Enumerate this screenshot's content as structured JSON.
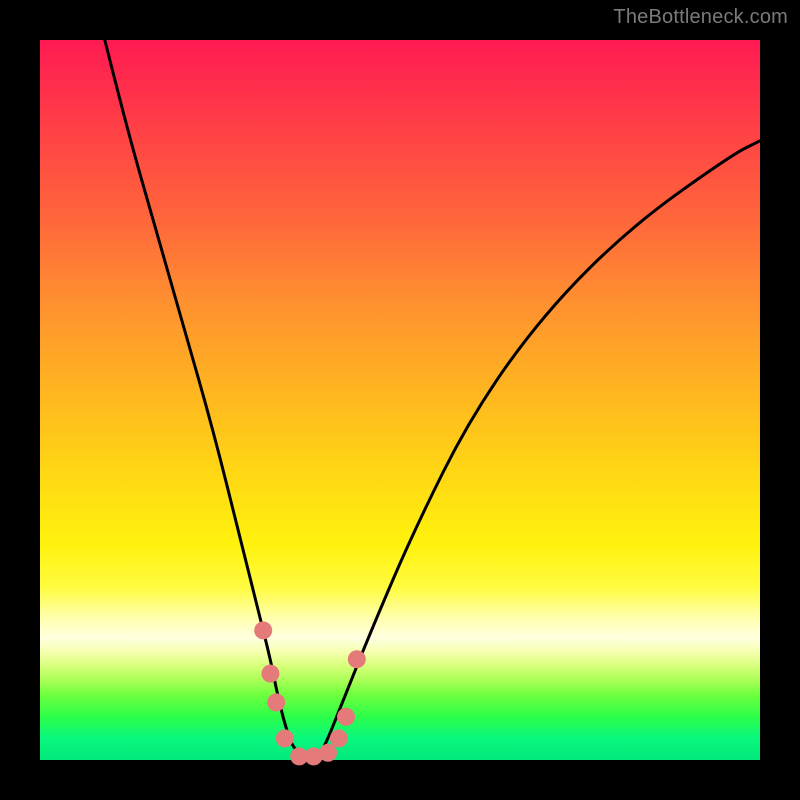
{
  "watermark": "TheBottleneck.com",
  "chart_data": {
    "type": "line",
    "title": "",
    "xlabel": "",
    "ylabel": "",
    "xlim": [
      0,
      100
    ],
    "ylim": [
      0,
      100
    ],
    "series": [
      {
        "name": "bottleneck-curve",
        "x": [
          9,
          12,
          16,
          20,
          24,
          28,
          30,
          32,
          33,
          34,
          35,
          36,
          37,
          38,
          39,
          40,
          42,
          46,
          52,
          60,
          70,
          82,
          96,
          100
        ],
        "y": [
          100,
          88,
          74,
          60,
          46,
          30,
          22,
          14,
          9,
          5,
          2,
          1,
          0,
          0,
          1,
          3,
          8,
          18,
          32,
          48,
          62,
          74,
          84,
          86
        ],
        "color": "#000000",
        "width": 3
      }
    ],
    "markers": [
      {
        "x": 31.0,
        "y": 18.0,
        "r": 9,
        "color": "#e47a7a"
      },
      {
        "x": 32.0,
        "y": 12.0,
        "r": 9,
        "color": "#e47a7a"
      },
      {
        "x": 32.8,
        "y": 8.0,
        "r": 9,
        "color": "#e47a7a"
      },
      {
        "x": 34.0,
        "y": 3.0,
        "r": 9,
        "color": "#e47a7a"
      },
      {
        "x": 36.0,
        "y": 0.5,
        "r": 9,
        "color": "#e47a7a"
      },
      {
        "x": 38.0,
        "y": 0.5,
        "r": 9,
        "color": "#e47a7a"
      },
      {
        "x": 40.0,
        "y": 1.0,
        "r": 9,
        "color": "#e47a7a"
      },
      {
        "x": 41.5,
        "y": 3.0,
        "r": 9,
        "color": "#e47a7a"
      },
      {
        "x": 42.5,
        "y": 6.0,
        "r": 9,
        "color": "#e47a7a"
      },
      {
        "x": 44.0,
        "y": 14.0,
        "r": 9,
        "color": "#e47a7a"
      }
    ],
    "gradient_stops": [
      {
        "pos": 0,
        "color": "#ff1a52"
      },
      {
        "pos": 50,
        "color": "#ffb321"
      },
      {
        "pos": 75,
        "color": "#fff20d"
      },
      {
        "pos": 83,
        "color": "#ffffe0"
      },
      {
        "pos": 100,
        "color": "#02e97b"
      }
    ]
  }
}
